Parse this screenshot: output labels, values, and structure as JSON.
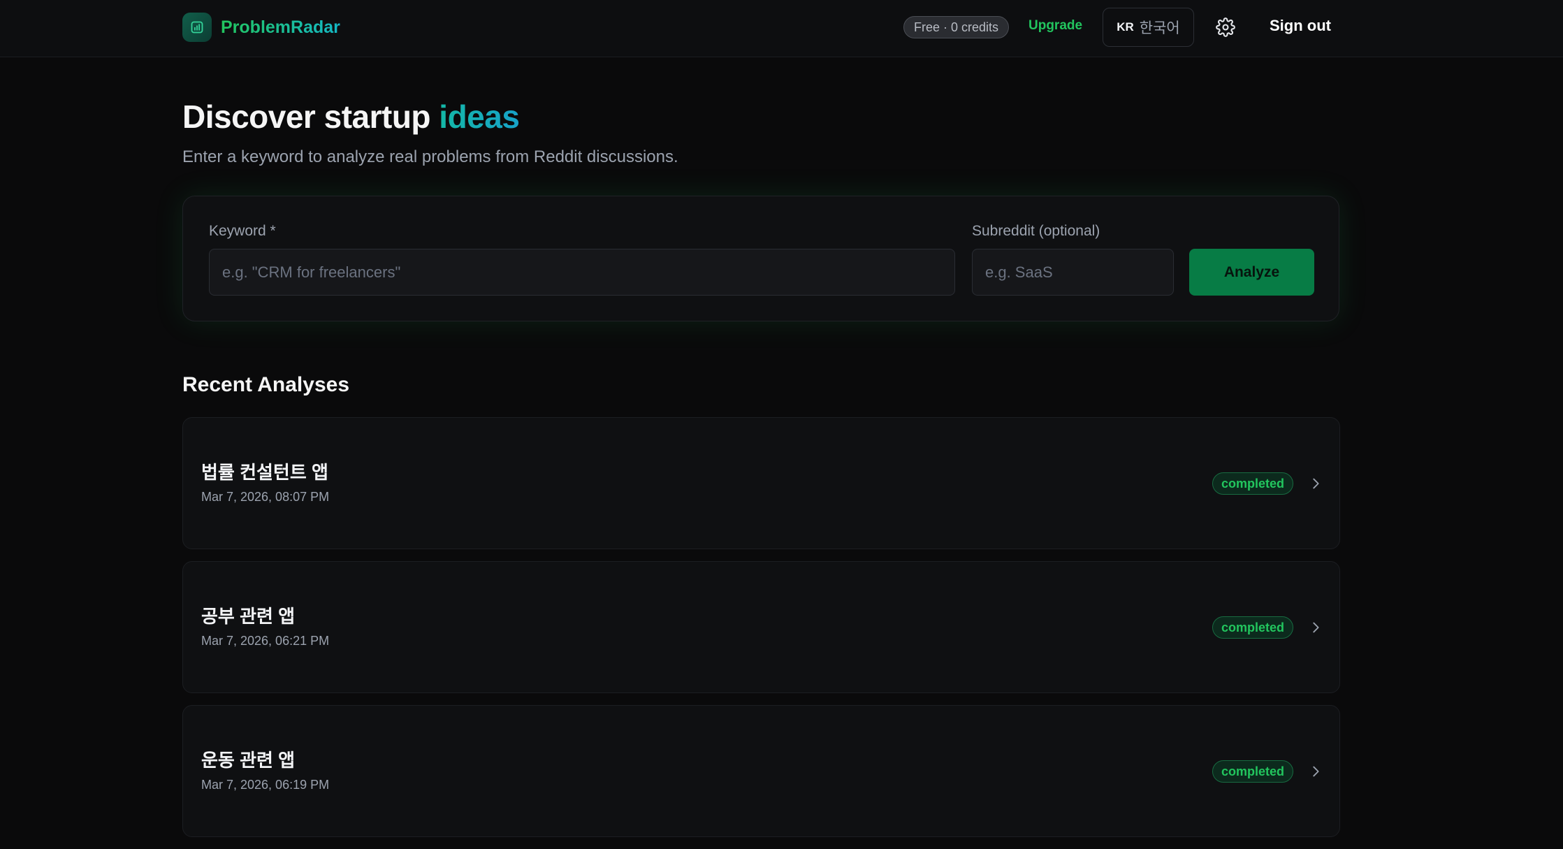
{
  "header": {
    "brand": "ProblemRadar",
    "credits": "Free · 0 credits",
    "upgrade": "Upgrade",
    "language": {
      "code": "KR",
      "label": "한국어"
    },
    "sign_out": "Sign out"
  },
  "hero": {
    "title_prefix": "Discover startup ",
    "title_accent": "ideas",
    "subtitle": "Enter a keyword to analyze real problems from Reddit discussions."
  },
  "search": {
    "keyword_label": "Keyword *",
    "keyword_placeholder": "e.g. \"CRM for freelancers\"",
    "subreddit_label": "Subreddit (optional)",
    "subreddit_placeholder": "e.g. SaaS",
    "analyze_label": "Analyze"
  },
  "recent": {
    "title": "Recent Analyses",
    "items": [
      {
        "title": "법률 컨설턴트 앱",
        "date": "Mar 7, 2026, 08:07 PM",
        "status": "completed"
      },
      {
        "title": "공부 관련 앱",
        "date": "Mar 7, 2026, 06:21 PM",
        "status": "completed"
      },
      {
        "title": "운동 관련 앱",
        "date": "Mar 7, 2026, 06:19 PM",
        "status": "completed"
      }
    ]
  },
  "colors": {
    "background": "#0a0a0b",
    "accent_green": "#22c55e",
    "accent_teal": "#14b8c6",
    "button_green": "#077c45"
  }
}
